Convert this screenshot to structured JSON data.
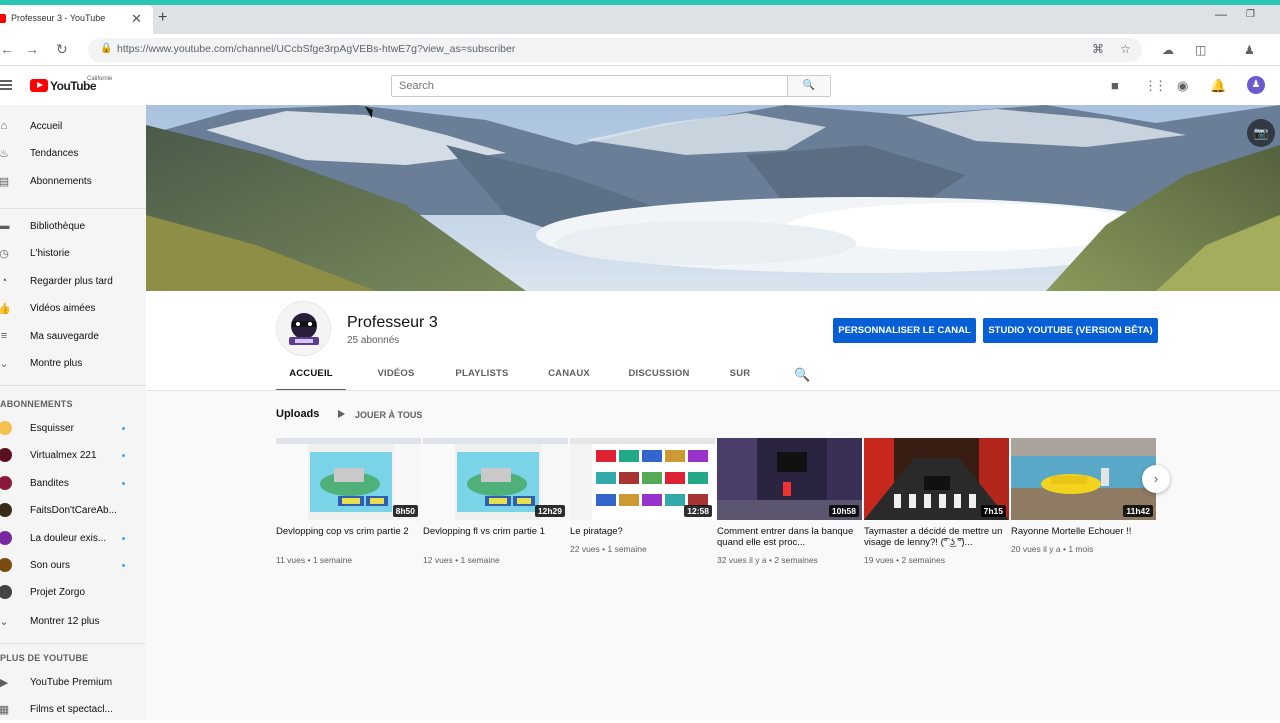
{
  "browser": {
    "tab_title": "Professeur 3 - YouTube",
    "close_glyph": "✕",
    "new_tab_glyph": "+",
    "url": "https://www.youtube.com/channel/UCcbSfge3rpAgVEBs-htwE7g?view_as=subscriber",
    "back_glyph": "←",
    "forward_glyph": "→",
    "reload_glyph": "↻",
    "lock_glyph": "🔒",
    "translate_glyph": "⌘",
    "star_glyph": "☆",
    "min_glyph": "—",
    "max_glyph": "❐"
  },
  "header": {
    "logo_text": "YouTube",
    "region": "Californie",
    "search_placeholder": "Search",
    "search_glyph": "🔍",
    "create_glyph": "■",
    "apps_glyph": "⋮⋮",
    "messages_glyph": "◉",
    "bell_glyph": "🔔",
    "avatar_glyph": "♟"
  },
  "sidebar": {
    "main": [
      {
        "label": "Accueil",
        "icon": "⌂"
      },
      {
        "label": "Tendances",
        "icon": "♨"
      },
      {
        "label": "Abonnements",
        "icon": "▤"
      }
    ],
    "library": [
      {
        "label": "Bibliothèque",
        "icon": "▬"
      },
      {
        "label": "L'historie",
        "icon": "◷"
      },
      {
        "label": "Regarder plus tard",
        "icon": "◔"
      },
      {
        "label": "Vidéos aimées",
        "icon": "👍"
      },
      {
        "label": "Ma sauvegarde",
        "icon": "≡"
      },
      {
        "label": "Montre plus",
        "icon": "⌄"
      }
    ],
    "subs_title": "ABONNEMENTS",
    "subscriptions": [
      {
        "label": "Esquisser",
        "color": "#f2c14e",
        "dot": true
      },
      {
        "label": "Virtualmex 221",
        "color": "#5a1020",
        "dot": true
      },
      {
        "label": "Bandites",
        "color": "#8b1a3a",
        "dot": true
      },
      {
        "label": "FaitsDon'tCareAb...",
        "color": "#3a2a1a",
        "dot": false
      },
      {
        "label": "La douleur exis...",
        "color": "#7a2aa0",
        "dot": true
      },
      {
        "label": "Son ours",
        "color": "#7a4a10",
        "dot": true
      },
      {
        "label": "Projet Zorgo",
        "color": "#444444",
        "dot": false
      }
    ],
    "show_more_subs": "Montrer 12 plus",
    "more_title": "PLUS DE YOUTUBE",
    "more": [
      {
        "label": "YouTube Premium",
        "icon": "▶"
      },
      {
        "label": "Films et spectacl...",
        "icon": "▦"
      }
    ]
  },
  "channel": {
    "name": "Professeur 3",
    "subscribers": "25 abonnés",
    "customize_label": "PERSONNALISER LE CANAL",
    "studio_label": "STUDIO YOUTUBE (VERSION BÊTA)",
    "camera_glyph": "📷",
    "avatar_glyph": "☠",
    "tabs": [
      "ACCUEIL",
      "VIDÉOS",
      "PLAYLISTS",
      "CANAUX",
      "DISCUSSION",
      "SUR"
    ],
    "tab_search_glyph": "🔍"
  },
  "uploads": {
    "title": "Uploads",
    "play_all": "JOUER À TOUS",
    "next_glyph": "›",
    "videos": [
      {
        "title": "Devlopping cop vs crim partie 2",
        "duration": "8h50",
        "views": "11 vues",
        "ago": "1 semaine",
        "theme": "roblox-editor"
      },
      {
        "title": "Devlopping fl vs crim partie 1",
        "duration": "12h29",
        "views": "12 vues",
        "ago": "1 semaine",
        "theme": "roblox-editor"
      },
      {
        "title": "Le piratage?",
        "duration": "12:58",
        "views": "22 vues",
        "ago": "1 semaine",
        "theme": "youtube-page"
      },
      {
        "title": "Comment entrer dans la banque quand elle est proc...",
        "duration": "10h58",
        "views": "32 vues il y a",
        "ago": "2 semaines",
        "theme": "night-street"
      },
      {
        "title": "Taymaster a décidé de mettre un visage de lenny?! (͡° ͜ʖ ͡°)...",
        "duration": "7h15",
        "views": "19 vues",
        "ago": "2 semaines",
        "theme": "crosswalk"
      },
      {
        "title": "Rayonne Mortelle Echouer !!",
        "duration": "11h42",
        "views": "20 vues il y a",
        "ago": "1 mois",
        "theme": "yellow-car"
      }
    ]
  },
  "colors": {
    "accent_strip": "#2bc5b4",
    "youtube_red": "#ff0000",
    "button_blue": "#065fd4"
  }
}
